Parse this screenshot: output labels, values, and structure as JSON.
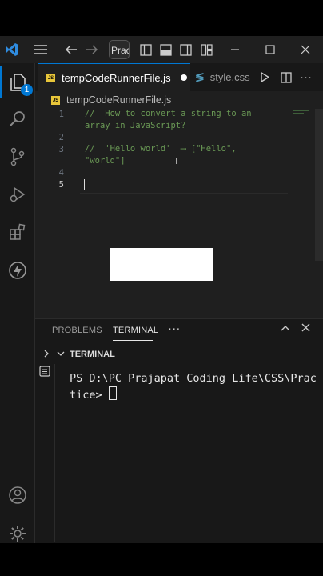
{
  "titlebar": {
    "search_text": "Prac",
    "icons": [
      "vscode-logo",
      "menu-icon",
      "back-arrow-icon",
      "forward-arrow-icon",
      "toggle-sidebar-icon",
      "toggle-panel-icon",
      "toggle-secondary-sidebar-icon",
      "customize-layout-icon",
      "minimize-icon",
      "maximize-icon",
      "close-icon"
    ]
  },
  "activity": {
    "explorer_badge": "1",
    "icons": [
      "explorer-icon",
      "search-icon",
      "source-control-icon",
      "run-debug-icon",
      "extensions-icon",
      "lightning-icon",
      "account-icon",
      "settings-gear-icon"
    ]
  },
  "tabs": [
    {
      "label": "tempCodeRunnerFile.js",
      "lang": "JS",
      "dirty": true
    },
    {
      "label": "style.css"
    }
  ],
  "breadcrumb": {
    "file": "tempCodeRunnerFile.js",
    "lang": "JS"
  },
  "editor": {
    "lines": [
      {
        "num": "1",
        "text": "//  How to convert a string to an array in JavaScript?"
      },
      {
        "num": "2",
        "text": ""
      },
      {
        "num": "3",
        "text": "//  'Hello world'  ⟶ [\"Hello\", \"world\"]"
      },
      {
        "num": "4",
        "text": ""
      },
      {
        "num": "5",
        "text": ""
      }
    ]
  },
  "panel": {
    "tabs": [
      "PROBLEMS",
      "TERMINAL"
    ],
    "active_tab": "TERMINAL",
    "section_label": "TERMINAL",
    "terminal_text": "PS D:\\PC Prajapat Coding Life\\CSS\\Practice> "
  },
  "colors": {
    "accent": "#0078d4",
    "comment": "#6a9955",
    "editor_bg": "#1f1f1f",
    "panel_bg": "#181818"
  }
}
